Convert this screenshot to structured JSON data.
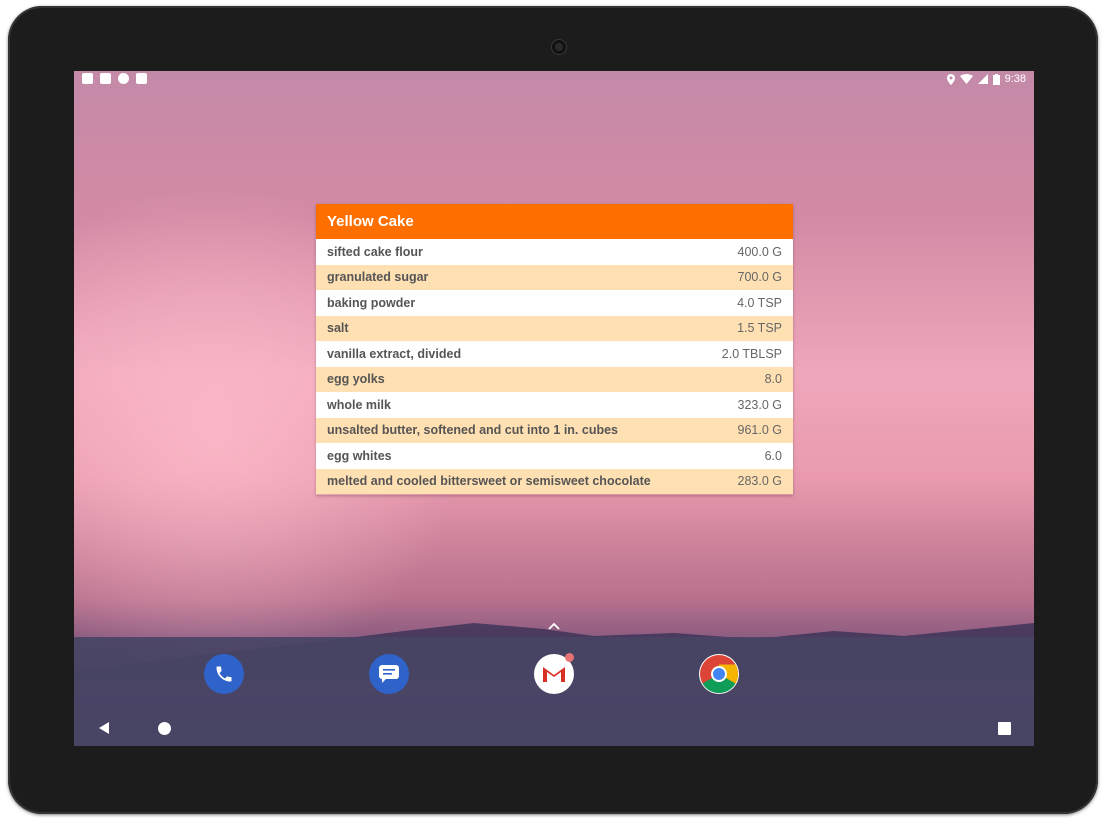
{
  "status_bar": {
    "time": "9:38",
    "left_icons": [
      "gmail-notification-icon",
      "a-notification-icon",
      "circle-notification-icon",
      "sd-card-icon"
    ],
    "right_icons": [
      "location-icon",
      "wifi-icon",
      "signal-icon",
      "battery-icon"
    ]
  },
  "widget": {
    "title": "Yellow Cake",
    "header_color": "#ff6f00",
    "row_alt_color": "#ffe0b2",
    "ingredients": [
      {
        "name": "sifted cake flour",
        "quantity": "400.0 G"
      },
      {
        "name": "granulated sugar",
        "quantity": "700.0 G"
      },
      {
        "name": "baking powder",
        "quantity": "4.0 TSP"
      },
      {
        "name": "salt",
        "quantity": "1.5 TSP"
      },
      {
        "name": "vanilla extract, divided",
        "quantity": "2.0 TBLSP"
      },
      {
        "name": "egg yolks",
        "quantity": "8.0"
      },
      {
        "name": "whole milk",
        "quantity": "323.0 G"
      },
      {
        "name": "unsalted butter, softened and cut into 1 in. cubes",
        "quantity": "961.0 G"
      },
      {
        "name": "egg whites",
        "quantity": "6.0"
      },
      {
        "name": "melted and cooled bittersweet or semisweet chocolate",
        "quantity": "283.0 G"
      }
    ]
  },
  "dock": {
    "apps": [
      "phone-app-icon",
      "messages-app-icon",
      "gmail-app-icon",
      "chrome-app-icon"
    ]
  },
  "nav": {
    "buttons": [
      "back-button",
      "home-button",
      "recents-button"
    ]
  }
}
